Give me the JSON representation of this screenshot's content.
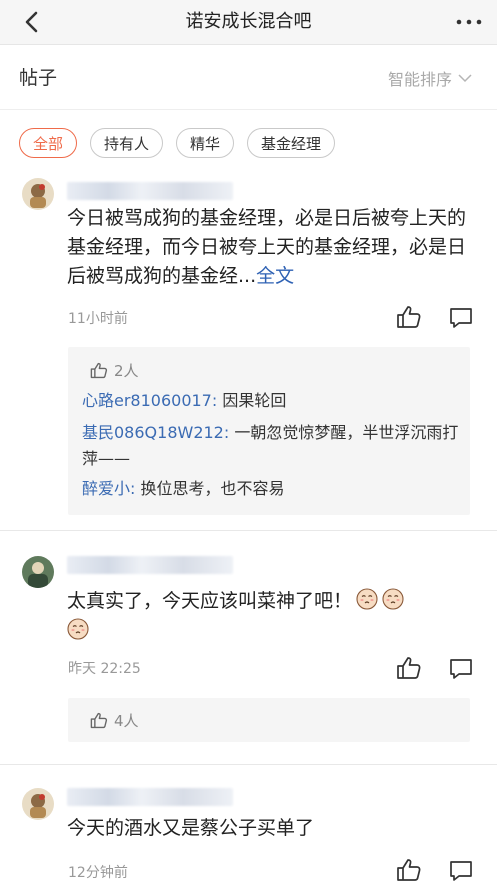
{
  "header": {
    "title": "诺安成长混合吧"
  },
  "section": {
    "label": "帖子",
    "sort_label": "智能排序"
  },
  "filters": [
    "全部",
    "持有人",
    "精华",
    "基金经理"
  ],
  "posts": [
    {
      "content": "今日被骂成狗的基金经理，必是日后被夸上天的基金经理，而今日被夸上天的基金经理，必是日后被骂成狗的基金经...",
      "more_link": "全文",
      "time": "11小时前",
      "likes": "2人",
      "replies": [
        {
          "name": "心路er81060017:",
          "text": " 因果轮回"
        },
        {
          "name": "基民086Q18W212:",
          "text": " 一朝忽觉惊梦醒，半世浮沉雨打萍——"
        },
        {
          "name": "醉爱小:",
          "text": " 换位思考，也不容易"
        }
      ]
    },
    {
      "content": "太真实了，今天应该叫菜神了吧！",
      "time": "昨天 22:25",
      "likes": "4人"
    },
    {
      "content": "今天的酒水又是蔡公子买单了",
      "time": "12分钟前"
    }
  ],
  "icons": {
    "back": "chevron-left-icon",
    "more": "more-dots-icon",
    "sort": "chevron-down-icon",
    "like": "thumbs-up-icon",
    "comment": "comment-icon",
    "emoji": "pray-face-emoji"
  },
  "colors": {
    "accent": "#ef6b4a",
    "link": "#2f62b4",
    "username": "#3b6bb3"
  }
}
